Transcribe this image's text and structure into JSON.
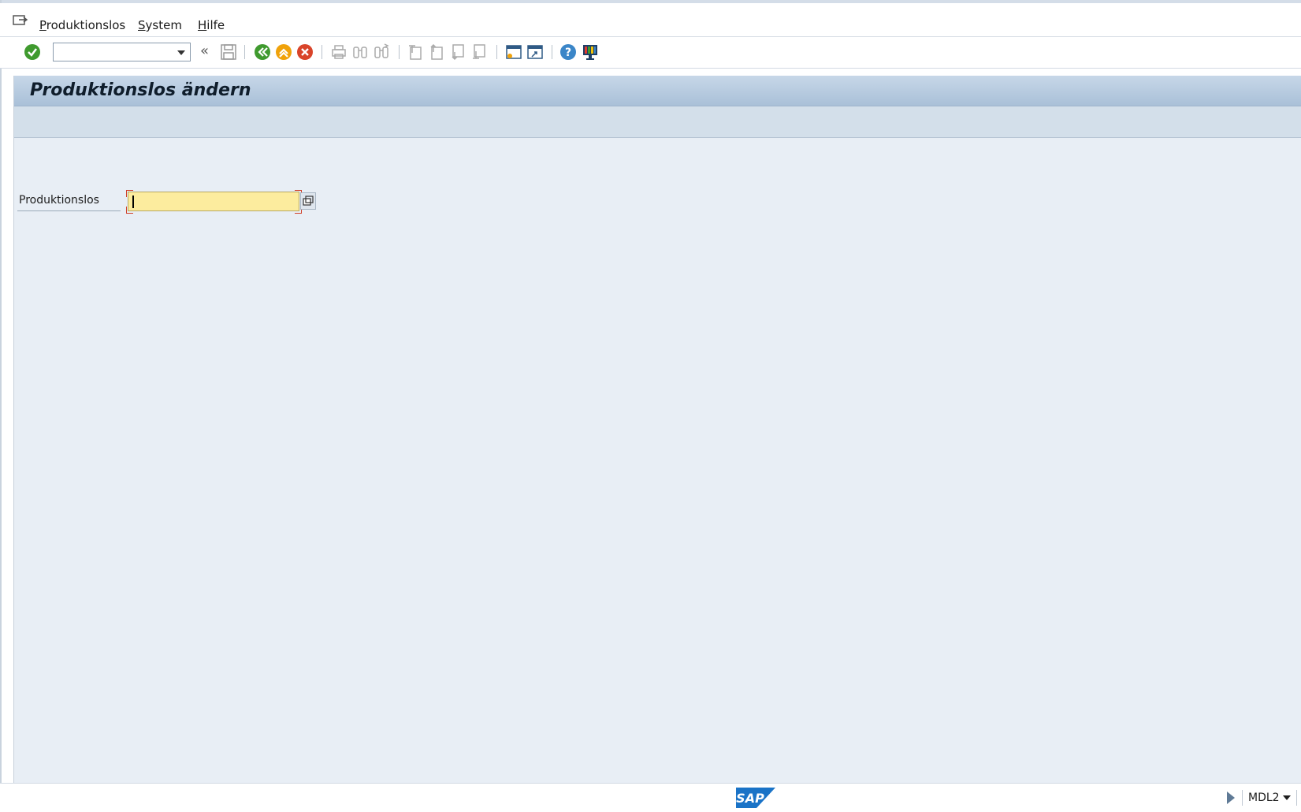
{
  "menubar": {
    "items": [
      {
        "label": "Produktionslos"
      },
      {
        "label": "System"
      },
      {
        "label": "Hilfe"
      }
    ]
  },
  "toolbar": {
    "command_field_value": "",
    "icons": [
      "enter-icon",
      "command-field",
      "dropdown-icon",
      "collapse-icon",
      "save-icon",
      "back-icon",
      "exit-icon",
      "cancel-icon",
      "print-icon",
      "find-icon",
      "find-next-icon",
      "first-page-icon",
      "previous-page-icon",
      "next-page-icon",
      "last-page-icon",
      "new-session-icon",
      "create-shortcut-icon",
      "help-icon",
      "customize-layout-icon"
    ]
  },
  "screen": {
    "title": "Produktionslos ändern"
  },
  "form": {
    "production_lot_label": "Produktionslos",
    "production_lot_value": ""
  },
  "status": {
    "logo_text": "SAP",
    "system_id": "MDL2"
  },
  "colors": {
    "content_bg": "#e8eef5",
    "title_bar": "#b5c9de",
    "required_field_bg": "#fcec9e",
    "enter_green": "#3f9a2e",
    "exit_orange": "#f0a20a",
    "cancel_red": "#d9442a",
    "sap_blue": "#1a73c7"
  }
}
